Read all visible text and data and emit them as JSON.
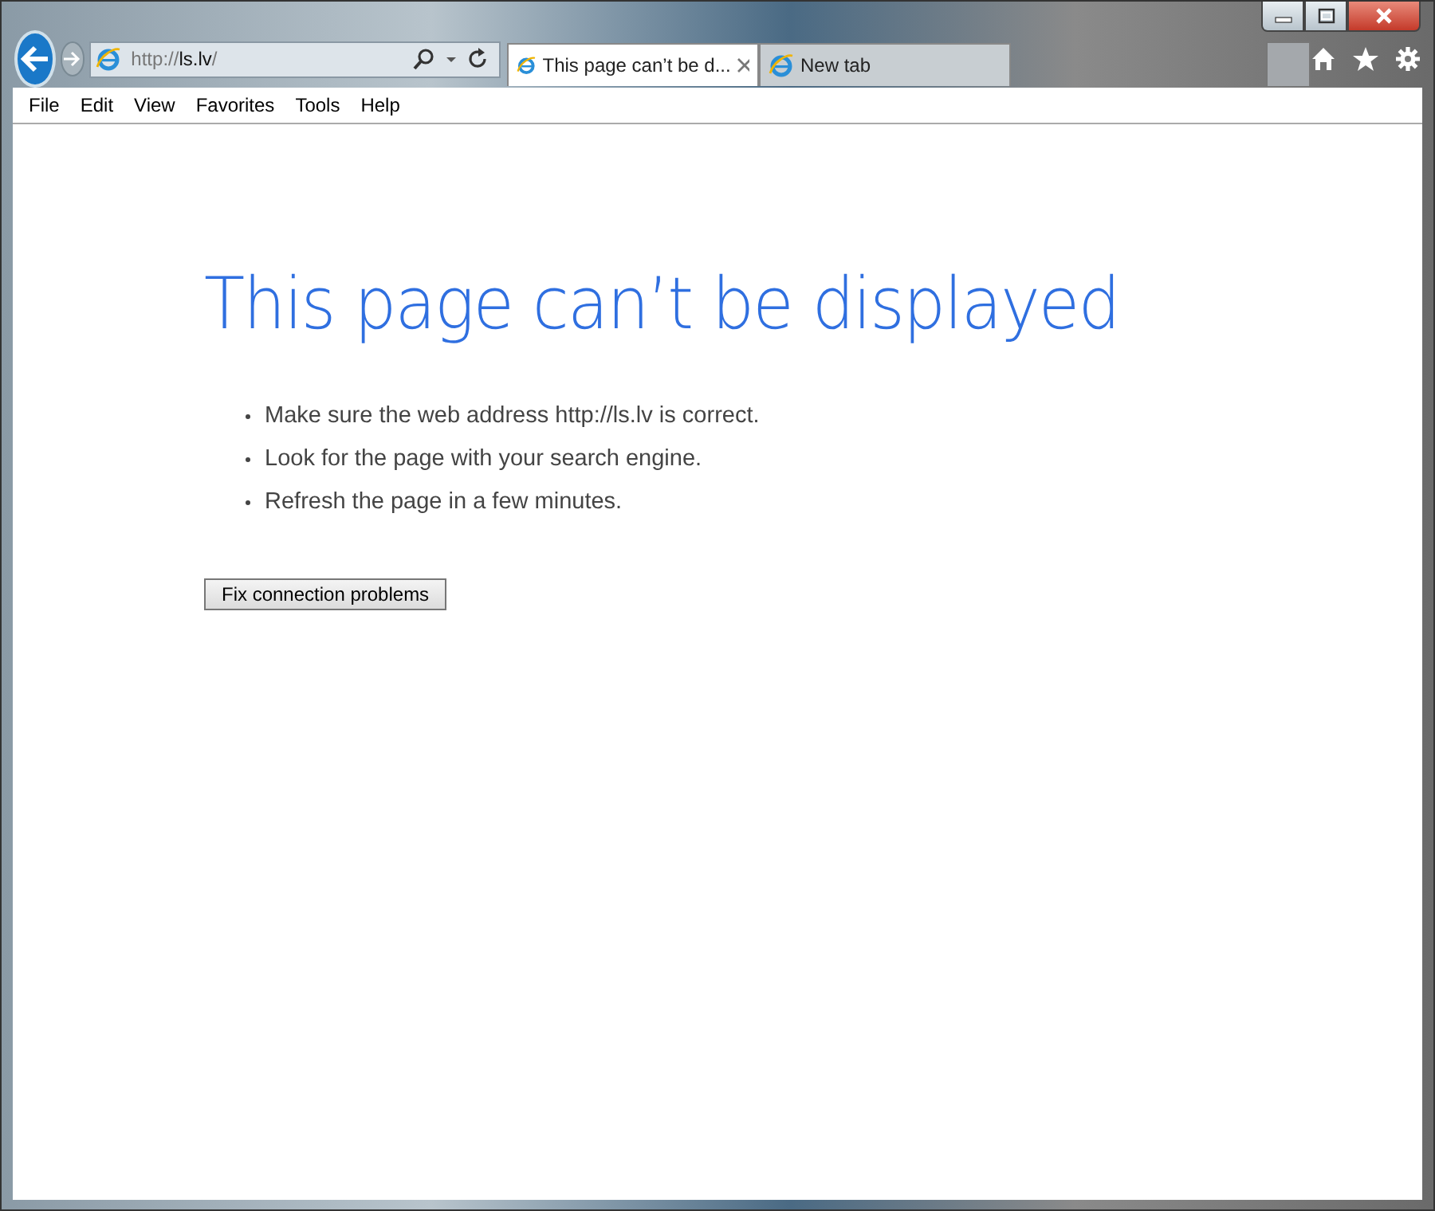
{
  "address_bar": {
    "url": "http://**ls.lv**/"
  },
  "tabs": [
    {
      "title": "This page can’t be d...",
      "selected": true,
      "closable": true
    },
    {
      "title": "New tab",
      "selected": false,
      "closable": false
    }
  ],
  "menu": [
    "File",
    "Edit",
    "View",
    "Favorites",
    "Tools",
    "Help"
  ],
  "page": {
    "heading": "This page can’t be displayed",
    "tips": [
      "Make sure the web address http://ls.lv is correct.",
      "Look for the page with your search engine.",
      "Refresh the page in a few minutes."
    ],
    "button": "Fix connection problems"
  }
}
